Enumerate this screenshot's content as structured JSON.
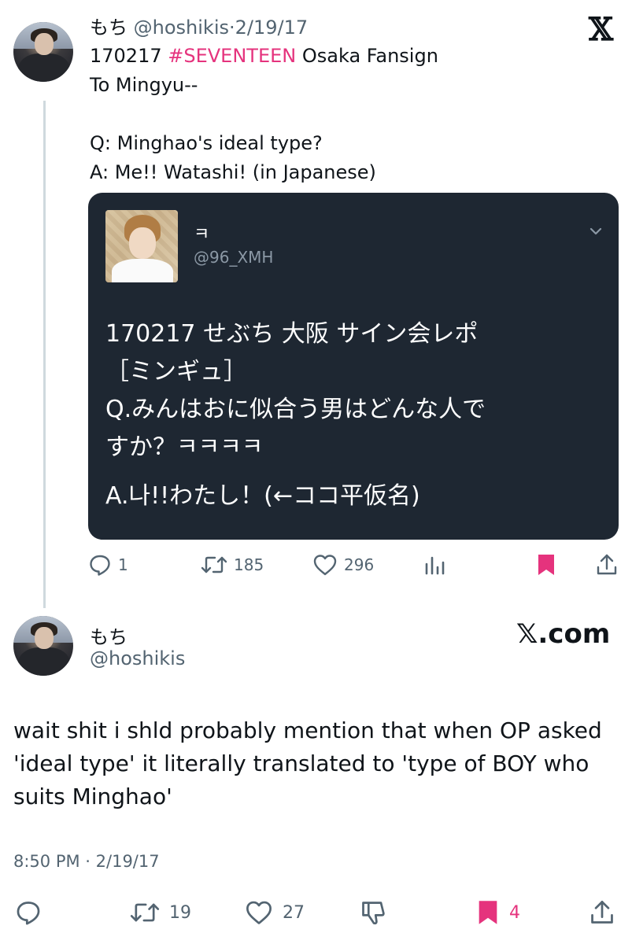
{
  "tweet1": {
    "display_name": "もち",
    "handle": "@hoshikis",
    "separator": "·",
    "date": "2/19/17",
    "line1_prefix": "170217 ",
    "line1_hashtag": "#SEVENTEEN",
    "line1_suffix": " Osaka Fansign",
    "line2": "To Mingyu--",
    "line3": "Q: Minghao's ideal type?",
    "line4": "A: Me!! Watashi! (in Japanese)",
    "logo": "𝕏"
  },
  "quote": {
    "display_name": "ㅋ",
    "handle": "@96_XMH",
    "lines": [
      "170217 せぶち 大阪 サイン会レポ",
      "［ミンギュ］",
      "Q.みんはおに似合う男はどんな人で",
      "すか？ㅋㅋㅋㅋ",
      "A.나!!わたし！(←ココ平仮名)"
    ]
  },
  "tweet1_actions": {
    "replies": "1",
    "retweets": "185",
    "likes": "296"
  },
  "tweet2": {
    "display_name": "もち",
    "handle": "@hoshikis",
    "brand": "𝕏.com",
    "text_lines": [
      "wait shit i shld probably mention that when OP asked",
      "'ideal type' it literally translated to 'type of BOY who",
      "suits Minghao'"
    ],
    "timestamp": "8:50 PM · 2/19/17"
  },
  "tweet2_actions": {
    "retweets": "19",
    "likes": "27",
    "bookmarks": "4"
  },
  "colors": {
    "hashtag": "#e5337d",
    "bookmark": "#e5337d",
    "secondary_text": "#536471",
    "quote_bg": "#1e2732"
  },
  "icons": [
    "reply-icon",
    "retweet-icon",
    "like-icon",
    "views-icon",
    "bookmark-icon",
    "share-icon",
    "dislike-icon",
    "chevron-down-icon",
    "x-logo-icon"
  ]
}
